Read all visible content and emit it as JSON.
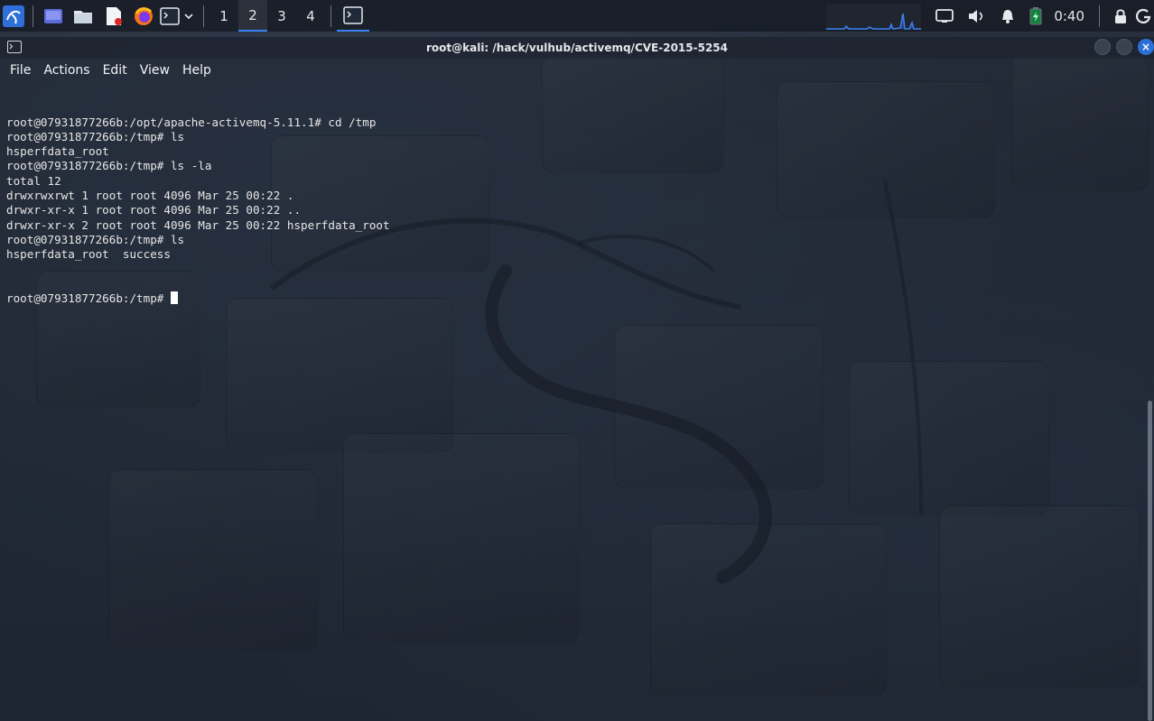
{
  "taskbar": {
    "workspaces": [
      {
        "label": "1",
        "active": false
      },
      {
        "label": "2",
        "active": true
      },
      {
        "label": "3",
        "active": false
      },
      {
        "label": "4",
        "active": false
      }
    ],
    "clock": "0:40",
    "accent": "#3b82f6"
  },
  "window": {
    "title": "root@kali: /hack/vulhub/activemq/CVE-2015-5254",
    "menu": [
      "File",
      "Actions",
      "Edit",
      "View",
      "Help"
    ]
  },
  "terminal": {
    "lines": [
      "root@07931877266b:/opt/apache-activemq-5.11.1# cd /tmp",
      "root@07931877266b:/tmp# ls",
      "hsperfdata_root",
      "root@07931877266b:/tmp# ls -la",
      "total 12",
      "drwxrwxrwt 1 root root 4096 Mar 25 00:22 .",
      "drwxr-xr-x 1 root root 4096 Mar 25 00:22 ..",
      "drwxr-xr-x 2 root root 4096 Mar 25 00:22 hsperfdata_root",
      "root@07931877266b:/tmp# ls",
      "hsperfdata_root  success"
    ],
    "prompt": "root@07931877266b:/tmp# "
  }
}
